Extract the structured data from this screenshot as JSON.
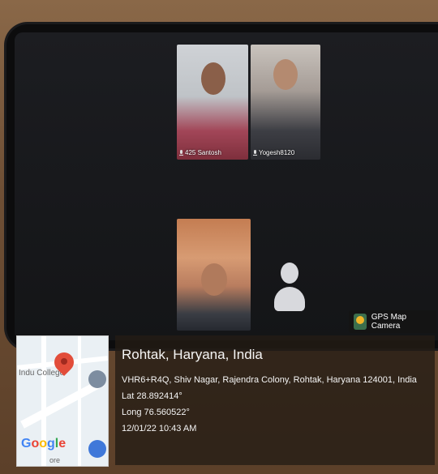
{
  "video_call": {
    "participants": [
      {
        "name": "425 Santosh"
      },
      {
        "name": "Yogesh8120"
      }
    ]
  },
  "overlay": {
    "brand_label": "GPS Map Camera",
    "map": {
      "place_fragment": "Indu College",
      "google_label": "Google",
      "bottom_text": "ore"
    },
    "place_title": "Rohtak, Haryana, India",
    "address": "VHR6+R4Q, Shiv Nagar, Rajendra Colony, Rohtak, Haryana 124001, India",
    "lat": "Lat 28.892414°",
    "long": "Long 76.560522°",
    "datetime": "12/01/22 10:43 AM"
  },
  "colors": {
    "pin": "#e24d3a",
    "google_blue": "#4285f4",
    "google_red": "#ea4335",
    "google_yellow": "#fbbc05",
    "google_green": "#34a853"
  }
}
